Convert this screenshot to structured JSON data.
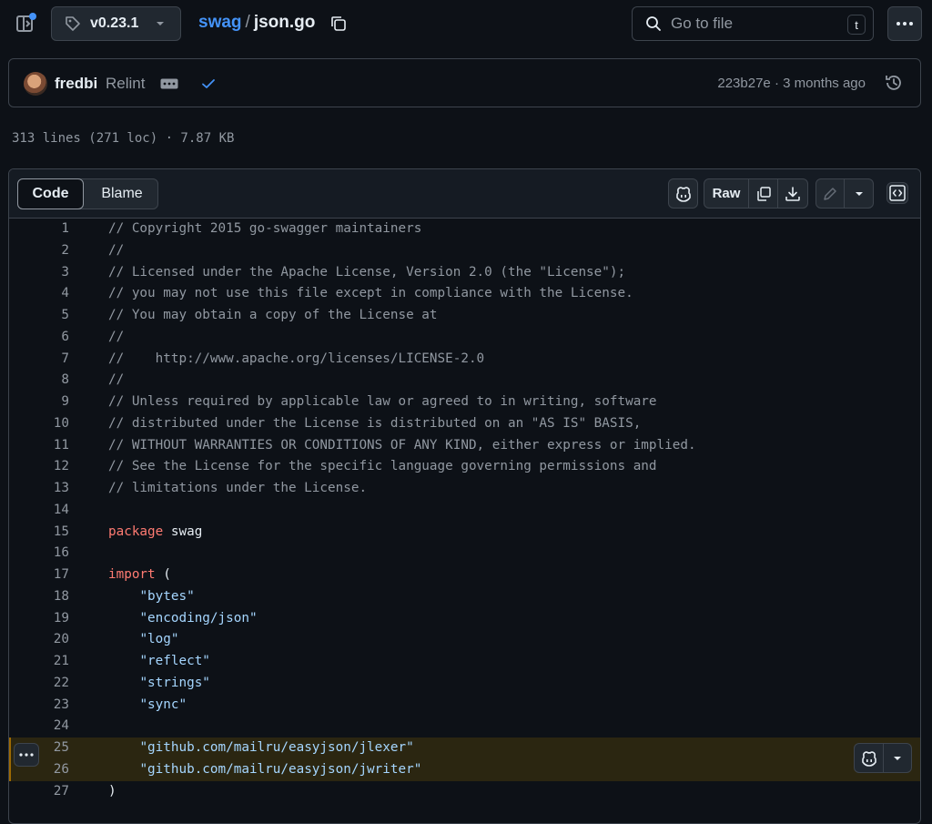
{
  "topbar": {
    "branch": "v0.23.1",
    "repo": "swag",
    "separator": "/",
    "file": "json.go",
    "search_placeholder": "Go to file",
    "search_shortcut": "t"
  },
  "commit": {
    "author": "fredbi",
    "message": "Relint",
    "hash_and_time": "223b27e · 3 months ago"
  },
  "file_stats": "313 lines (271 loc) · 7.87 KB",
  "tabs": {
    "code": "Code",
    "blame": "Blame"
  },
  "toolbar": {
    "raw": "Raw"
  },
  "code": {
    "highlighted_lines": [
      25,
      26
    ],
    "lines": [
      {
        "n": "1",
        "parts": [
          {
            "t": "// Copyright 2015 go-swagger maintainers",
            "c": "com"
          }
        ]
      },
      {
        "n": "2",
        "parts": [
          {
            "t": "//",
            "c": "com"
          }
        ]
      },
      {
        "n": "3",
        "parts": [
          {
            "t": "// Licensed under the Apache License, Version 2.0 (the \"License\");",
            "c": "com"
          }
        ]
      },
      {
        "n": "4",
        "parts": [
          {
            "t": "// you may not use this file except in compliance with the License.",
            "c": "com"
          }
        ]
      },
      {
        "n": "5",
        "parts": [
          {
            "t": "// You may obtain a copy of the License at",
            "c": "com"
          }
        ]
      },
      {
        "n": "6",
        "parts": [
          {
            "t": "//",
            "c": "com"
          }
        ]
      },
      {
        "n": "7",
        "parts": [
          {
            "t": "//    http://www.apache.org/licenses/LICENSE-2.0",
            "c": "com"
          }
        ]
      },
      {
        "n": "8",
        "parts": [
          {
            "t": "//",
            "c": "com"
          }
        ]
      },
      {
        "n": "9",
        "parts": [
          {
            "t": "// Unless required by applicable law or agreed to in writing, software",
            "c": "com"
          }
        ]
      },
      {
        "n": "10",
        "parts": [
          {
            "t": "// distributed under the License is distributed on an \"AS IS\" BASIS,",
            "c": "com"
          }
        ]
      },
      {
        "n": "11",
        "parts": [
          {
            "t": "// WITHOUT WARRANTIES OR CONDITIONS OF ANY KIND, either express or implied.",
            "c": "com"
          }
        ]
      },
      {
        "n": "12",
        "parts": [
          {
            "t": "// See the License for the specific language governing permissions and",
            "c": "com"
          }
        ]
      },
      {
        "n": "13",
        "parts": [
          {
            "t": "// limitations under the License.",
            "c": "com"
          }
        ]
      },
      {
        "n": "14",
        "parts": []
      },
      {
        "n": "15",
        "parts": [
          {
            "t": "package",
            "c": "kw"
          },
          {
            "t": " swag",
            "c": ""
          }
        ]
      },
      {
        "n": "16",
        "parts": []
      },
      {
        "n": "17",
        "parts": [
          {
            "t": "import",
            "c": "kw"
          },
          {
            "t": " (",
            "c": ""
          }
        ]
      },
      {
        "n": "18",
        "parts": [
          {
            "t": "    ",
            "c": ""
          },
          {
            "t": "\"bytes\"",
            "c": "str"
          }
        ]
      },
      {
        "n": "19",
        "parts": [
          {
            "t": "    ",
            "c": ""
          },
          {
            "t": "\"encoding/json\"",
            "c": "str"
          }
        ]
      },
      {
        "n": "20",
        "parts": [
          {
            "t": "    ",
            "c": ""
          },
          {
            "t": "\"log\"",
            "c": "str"
          }
        ]
      },
      {
        "n": "21",
        "parts": [
          {
            "t": "    ",
            "c": ""
          },
          {
            "t": "\"reflect\"",
            "c": "str"
          }
        ]
      },
      {
        "n": "22",
        "parts": [
          {
            "t": "    ",
            "c": ""
          },
          {
            "t": "\"strings\"",
            "c": "str"
          }
        ]
      },
      {
        "n": "23",
        "parts": [
          {
            "t": "    ",
            "c": ""
          },
          {
            "t": "\"sync\"",
            "c": "str"
          }
        ]
      },
      {
        "n": "24",
        "parts": []
      },
      {
        "n": "25",
        "parts": [
          {
            "t": "    ",
            "c": ""
          },
          {
            "t": "\"github.com/mailru/easyjson/jlexer\"",
            "c": "str"
          }
        ]
      },
      {
        "n": "26",
        "parts": [
          {
            "t": "    ",
            "c": ""
          },
          {
            "t": "\"github.com/mailru/easyjson/jwriter\"",
            "c": "str"
          }
        ]
      },
      {
        "n": "27",
        "parts": [
          {
            "t": ")",
            "c": ""
          }
        ]
      }
    ]
  },
  "colors": {
    "background": "#0d1117",
    "link": "#4493f8",
    "comment": "#9198a1",
    "keyword": "#ff7b72",
    "string": "#a5d6ff",
    "highlight_bg": "#2b2611",
    "highlight_bar": "#9e6a03",
    "notification_dot": "#4493f8",
    "check": "#4493f8"
  },
  "icons": [
    "sidebar-toggle-icon",
    "tag-icon",
    "chevron-down-icon",
    "copy-icon",
    "search-icon",
    "kebab-icon",
    "avatar",
    "ellipsis-icon",
    "check-icon",
    "history-icon",
    "copilot-icon",
    "download-icon",
    "pencil-icon",
    "code-symbols-icon"
  ]
}
